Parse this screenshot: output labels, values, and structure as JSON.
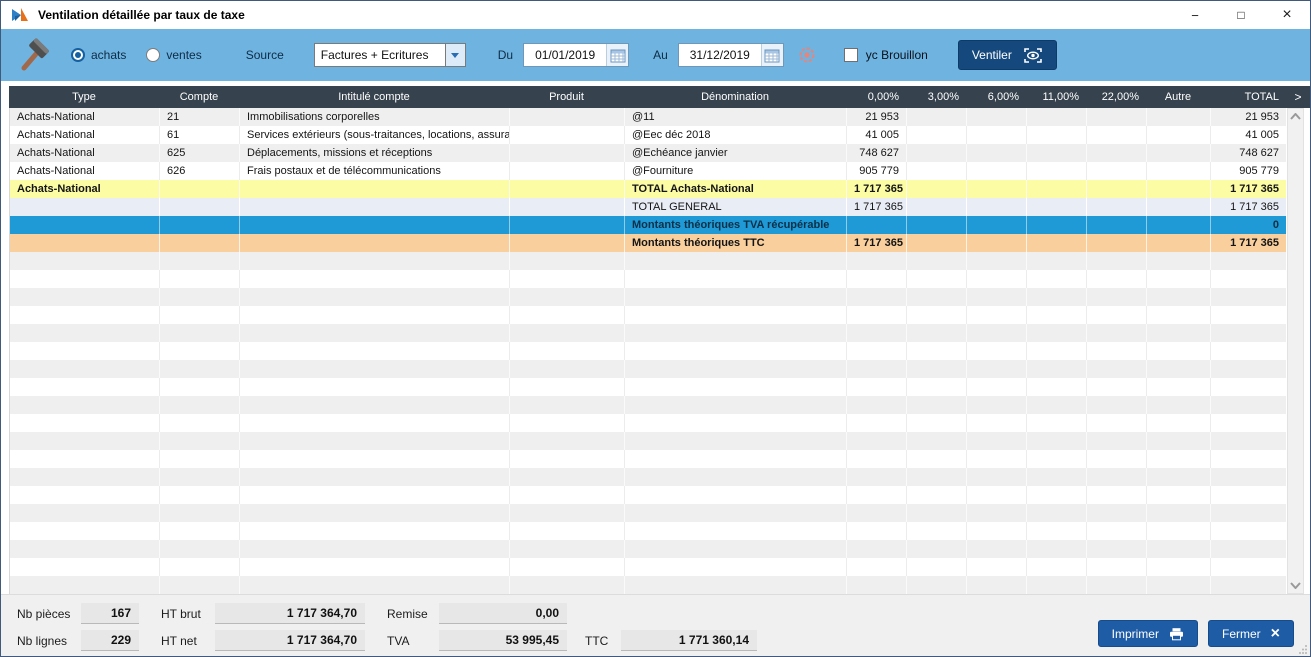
{
  "window": {
    "title": "Ventilation détaillée par taux de taxe",
    "minimize_glyph": "−",
    "maximize_glyph": "□",
    "close_glyph": "×"
  },
  "toolbar": {
    "achats_label": "achats",
    "ventes_label": "ventes",
    "source_label": "Source",
    "source_value": "Factures + Ecritures",
    "du_label": "Du",
    "du_value": "01/01/2019",
    "au_label": "Au",
    "au_value": "31/12/2019",
    "brouillon_label": "yc Brouillon",
    "ventiler_label": "Ventiler"
  },
  "table": {
    "columns": [
      "Type",
      "Compte",
      "Intitulé compte",
      "Produit",
      "Dénomination",
      "0,00%",
      "3,00%",
      "6,00%",
      "11,00%",
      "22,00%",
      "Autre",
      "TOTAL"
    ],
    "scroll_right_glyph": ">",
    "rows": [
      {
        "cells": [
          "Achats-National",
          "21",
          "Immobilisations corporelles",
          "",
          "@11",
          "21 953",
          "",
          "",
          "",
          "",
          "",
          "21 953"
        ]
      },
      {
        "cells": [
          "Achats-National",
          "61",
          "Services extérieurs (sous-traitances, locations, assura",
          "",
          "@Eec déc 2018",
          "41 005",
          "",
          "",
          "",
          "",
          "",
          "41 005"
        ]
      },
      {
        "cells": [
          "Achats-National",
          "625",
          "Déplacements, missions et réceptions",
          "",
          "@Echéance janvier",
          "748 627",
          "",
          "",
          "",
          "",
          "",
          "748 627"
        ]
      },
      {
        "cells": [
          "Achats-National",
          "626",
          "Frais postaux et de télécommunications",
          "",
          "@Fourniture",
          "905 779",
          "",
          "",
          "",
          "",
          "",
          "905 779"
        ]
      },
      {
        "cells": [
          "Achats-National",
          "",
          "",
          "",
          "TOTAL Achats-National",
          "1 717 365",
          "",
          "",
          "",
          "",
          "",
          "1 717 365"
        ]
      },
      {
        "cells": [
          "",
          "",
          "",
          "",
          "TOTAL GENERAL",
          "1 717 365",
          "",
          "",
          "",
          "",
          "",
          "1 717 365"
        ]
      },
      {
        "cells": [
          "",
          "",
          "",
          "",
          "Montants théoriques TVA récupérable",
          "",
          "",
          "",
          "",
          "",
          "",
          "0"
        ]
      },
      {
        "cells": [
          "",
          "",
          "",
          "",
          "Montants théoriques TTC",
          "1 717 365",
          "",
          "",
          "",
          "",
          "",
          "1 717 365"
        ]
      }
    ]
  },
  "footer": {
    "nb_pieces_label": "Nb pièces",
    "nb_pieces_value": "167",
    "ht_brut_label": "HT brut",
    "ht_brut_value": "1 717 364,70",
    "remise_label": "Remise",
    "remise_value": "0,00",
    "nb_lignes_label": "Nb lignes",
    "nb_lignes_value": "229",
    "ht_net_label": "HT net",
    "ht_net_value": "1 717 364,70",
    "tva_label": "TVA",
    "tva_value": "53 995,45",
    "ttc_label": "TTC",
    "ttc_value": "1 771 360,14",
    "imprimer_label": "Imprimer",
    "fermer_label": "Fermer",
    "fermer_icon_glyph": "×"
  },
  "colors": {
    "toolbar": "#6fb3e0",
    "table_header": "#36424d",
    "row_stripe": "#efefef",
    "row_yellow": "#fcfca5",
    "row_total_general": "#e9edf6",
    "row_blue": "#1f9ad6",
    "row_orange": "#f8cf9d",
    "ventiler_button": "#15497e",
    "action_button": "#1e5ca6"
  }
}
